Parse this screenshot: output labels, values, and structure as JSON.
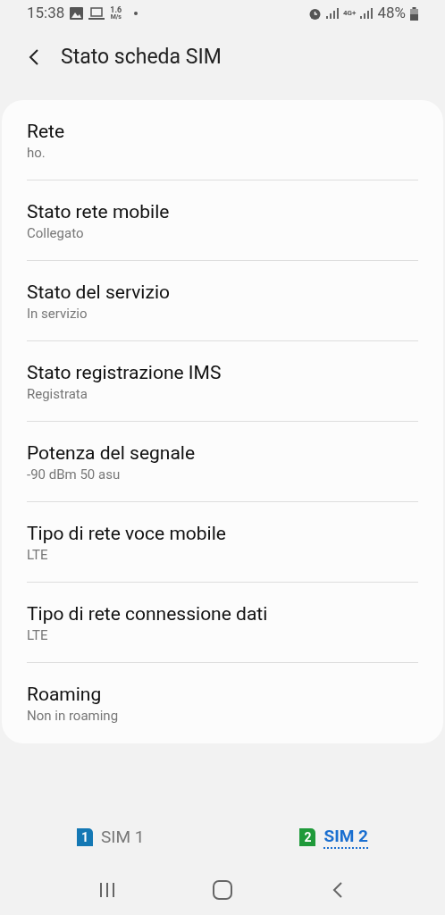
{
  "status_bar": {
    "time": "15:38",
    "speed_value": "1.6",
    "speed_unit": "M/s",
    "network_type": "4G+",
    "battery": "48%"
  },
  "header": {
    "title": "Stato scheda SIM"
  },
  "items": [
    {
      "title": "Rete",
      "value": "ho."
    },
    {
      "title": "Stato rete mobile",
      "value": "Collegato"
    },
    {
      "title": "Stato del servizio",
      "value": "In servizio"
    },
    {
      "title": "Stato registrazione IMS",
      "value": "Registrata"
    },
    {
      "title": "Potenza del segnale",
      "value": "-90 dBm 50 asu"
    },
    {
      "title": "Tipo di rete voce mobile",
      "value": "LTE"
    },
    {
      "title": "Tipo di rete connessione dati",
      "value": "LTE"
    },
    {
      "title": "Roaming",
      "value": "Non in roaming"
    }
  ],
  "sim_tabs": [
    {
      "badge": "1",
      "label": "SIM 1",
      "color": "#1478b4",
      "selected": false
    },
    {
      "badge": "2",
      "label": "SIM 2",
      "color": "#1f9a3a",
      "selected": true
    }
  ]
}
